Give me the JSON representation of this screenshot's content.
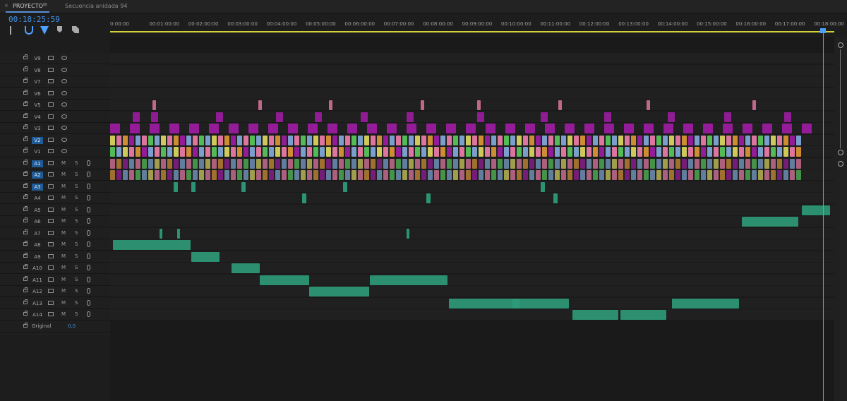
{
  "tabs": {
    "project_label": "PROYECTO",
    "menu_icon": "hamburger-menu-icon",
    "sequence_label": "Secuencia anidada 94"
  },
  "timecode": "00:18:25:59",
  "ruler": [
    "0:00:00",
    "00:01:00:00",
    "00:02:00:00",
    "00:03:00:00",
    "00:04:00:00",
    "00:05:00:00",
    "00:06:00:00",
    "00:07:00:00",
    "00:08:00:00",
    "00:09:00:00",
    "00:10:00:00",
    "00:11:00:00",
    "00:12:00:00",
    "00:13:00:00",
    "00:14:00:00",
    "00:15:00:00",
    "00:16:00:00",
    "00:17:00:00",
    "00:18:00:00"
  ],
  "video_tracks": [
    "V9",
    "V8",
    "V7",
    "V6",
    "V5",
    "V4",
    "V3",
    "V2",
    "V1"
  ],
  "audio_tracks": [
    "A1",
    "A2",
    "A3",
    "A4",
    "A5",
    "A6",
    "A7",
    "A8",
    "A9",
    "A10",
    "A11",
    "A12",
    "A13",
    "A14"
  ],
  "audio_controls": {
    "mute_label": "M",
    "solo_label": "S"
  },
  "original_row": {
    "label": "Original",
    "value": "0,0"
  },
  "colors": {
    "accent": "#3f93e8",
    "clip_magenta": "#9b1c9f",
    "clip_pink": "#e97aa6",
    "clip_blue": "#7fa6d6",
    "clip_green": "#55c45a",
    "clip_yellow": "#d8d45e",
    "clip_orange": "#d79434",
    "clip_teal": "#2c9b79"
  }
}
